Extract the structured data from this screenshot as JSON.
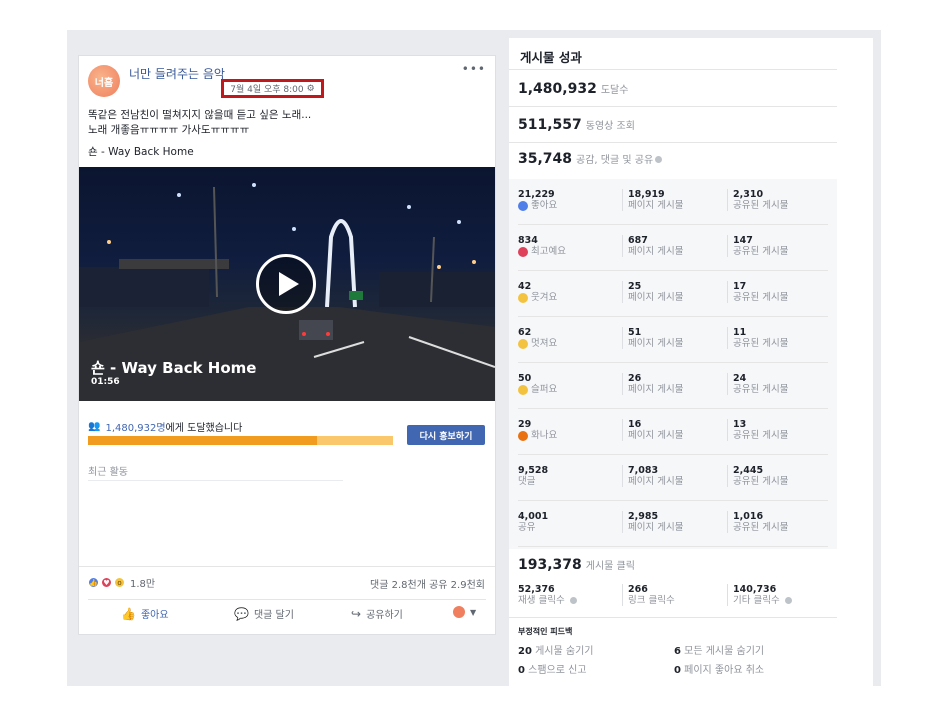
{
  "post": {
    "page_name": "너만 들려주는 음악",
    "avatar_text": "너흠",
    "timestamp": "7월 4일 오후 8:00",
    "more": "•••",
    "text_line1": "똑같은 전남친이 떨쳐지지 않을때 듣고 싶은 노래...",
    "text_line2": "노래 개좋음ㅠㅠㅠㅠ 가사도ㅠㅠㅠㅠ",
    "song_line": "숀 - Way Back Home",
    "video_title": "숀 - Way Back Home",
    "video_duration": "01:56",
    "reach_number": "1,480,932명",
    "reach_suffix": "에게 도달했습니다",
    "boost_label": "다시 홍보하기",
    "recent_activity": "최근 활동",
    "reaction_count": "1.8만",
    "comment_share": "댓글 2.8천개  공유 2.9천회",
    "actions": {
      "like": "좋아요",
      "comment": "댓글 달기",
      "share": "공유하기"
    },
    "progress_fraction": 0.75
  },
  "panel": {
    "title": "게시물 성과",
    "reach": {
      "value": "1,480,932",
      "label": "도달수"
    },
    "views": {
      "value": "511,557",
      "label": "동영상 조회"
    },
    "engagement": {
      "value": "35,748",
      "label": "공감, 댓글 및 공유"
    },
    "rows": [
      {
        "total": "21,229",
        "label": "좋아요",
        "emoji": "like",
        "page": "18,919",
        "page_label": "페이지 게시물",
        "shared": "2,310",
        "shared_label": "공유된 게시물"
      },
      {
        "total": "834",
        "label": "최고예요",
        "emoji": "love",
        "page": "687",
        "page_label": "페이지 게시물",
        "shared": "147",
        "shared_label": "공유된 게시물"
      },
      {
        "total": "42",
        "label": "웃겨요",
        "emoji": "haha",
        "page": "25",
        "page_label": "페이지 게시물",
        "shared": "17",
        "shared_label": "공유된 게시물"
      },
      {
        "total": "62",
        "label": "멋져요",
        "emoji": "wow",
        "page": "51",
        "page_label": "페이지 게시물",
        "shared": "11",
        "shared_label": "공유된 게시물"
      },
      {
        "total": "50",
        "label": "슬퍼요",
        "emoji": "sad",
        "page": "26",
        "page_label": "페이지 게시물",
        "shared": "24",
        "shared_label": "공유된 게시물"
      },
      {
        "total": "29",
        "label": "화나요",
        "emoji": "angry",
        "page": "16",
        "page_label": "페이지 게시물",
        "shared": "13",
        "shared_label": "공유된 게시물"
      },
      {
        "total": "9,528",
        "label": "댓글",
        "emoji": "",
        "page": "7,083",
        "page_label": "페이지 게시물",
        "shared": "2,445",
        "shared_label": "공유된 게시물"
      },
      {
        "total": "4,001",
        "label": "공유",
        "emoji": "",
        "page": "2,985",
        "page_label": "페이지 게시물",
        "shared": "1,016",
        "shared_label": "공유된 게시물"
      }
    ],
    "clicks": {
      "value": "193,378",
      "label": "게시물 클릭"
    },
    "click_breakdown": {
      "play": "52,376",
      "play_label": "재생 클릭수",
      "link": "266",
      "link_label": "링크 클릭수",
      "other": "140,736",
      "other_label": "기타 클릭수"
    },
    "negative": {
      "title": "부정적인 피드백",
      "hide_post_n": "20",
      "hide_post": "게시물 숨기기",
      "hide_all_n": "6",
      "hide_all": "모든 게시물 숨기기",
      "spam_n": "0",
      "spam": "스팸으로 신고",
      "unlike_n": "0",
      "unlike": "페이지 좋아요 취소"
    }
  },
  "colors": {
    "accent": "#4267b2",
    "highlight_box": "#c0181b",
    "progress": "#f29c1f"
  }
}
